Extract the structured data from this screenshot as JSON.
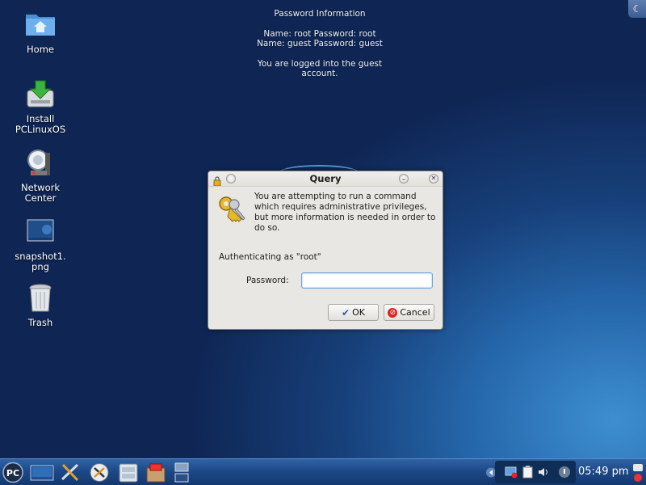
{
  "desktop_info": {
    "title": "Password Information",
    "line1": "Name: root  Password: root",
    "line2": "Name: guest Password: guest",
    "line3": "You are logged into the guest\naccount."
  },
  "desktop_icons": [
    {
      "label": "Home",
      "icon": "folder-home-icon"
    },
    {
      "label": "Install\nPCLinuxOS",
      "icon": "install-drive-icon"
    },
    {
      "label": "Network\nCenter",
      "icon": "network-center-icon"
    },
    {
      "label": "snapshot1.\npng",
      "icon": "image-thumbnail-icon"
    },
    {
      "label": "Trash",
      "icon": "trash-icon"
    }
  ],
  "dialog": {
    "title": "Query",
    "message": "You are attempting to run a command which requires administrative privileges, but more information is needed in order to do so.",
    "auth_text": "Authenticating as \"root\"",
    "password_label": "Password:",
    "password_value": "",
    "ok_label": "OK",
    "cancel_label": "Cancel"
  },
  "taskbar": {
    "start_label": "PC",
    "clock": "05:49 pm"
  },
  "colors": {
    "taskbar": "#1c4786",
    "dialog_bg": "#e9e7e3",
    "input_focus": "#6fa0d8"
  }
}
